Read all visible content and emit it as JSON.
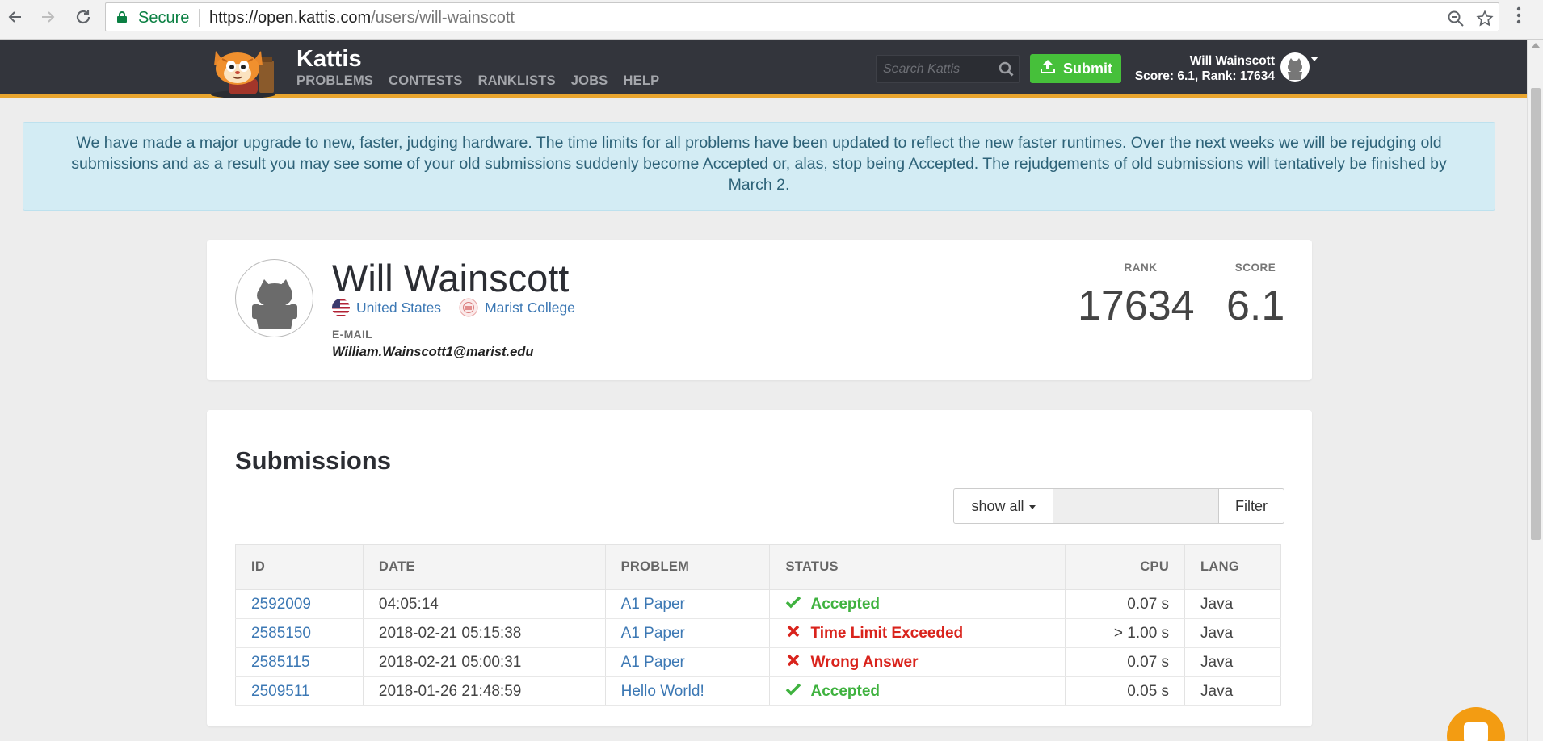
{
  "browser": {
    "secure_label": "Secure",
    "url_host": "https://open.kattis.com",
    "url_path": "/users/will-wainscott"
  },
  "header": {
    "brand": "Kattis",
    "nav": [
      "PROBLEMS",
      "CONTESTS",
      "RANKLISTS",
      "JOBS",
      "HELP"
    ],
    "search_placeholder": "Search Kattis",
    "submit_label": "Submit",
    "user_name": "Will Wainscott",
    "user_stats": "Score: 6.1, Rank: 17634"
  },
  "alert": {
    "text": "We have made a major upgrade to new, faster, judging hardware. The time limits for all problems have been updated to reflect the new faster runtimes. Over the next weeks we will be rejudging old submissions and as a result you may see some of your old submissions suddenly become Accepted or, alas, stop being Accepted. The rejudgements of old submissions will tentatively be finished by March 2."
  },
  "profile": {
    "name": "Will Wainscott",
    "country": "United States",
    "school": "Marist College",
    "email_label": "E-MAIL",
    "email": "William.Wainscott1@marist.edu",
    "rank_label": "RANK",
    "rank": "17634",
    "score_label": "SCORE",
    "score": "6.1"
  },
  "submissions": {
    "title": "Submissions",
    "filter_dropdown": "show all",
    "filter_input_value": "",
    "filter_button": "Filter",
    "columns": [
      "ID",
      "DATE",
      "PROBLEM",
      "STATUS",
      "CPU",
      "LANG"
    ],
    "rows": [
      {
        "id": "2592009",
        "date": "04:05:14",
        "problem": "A1 Paper",
        "status": "Accepted",
        "cpu": "0.07 s",
        "lang": "Java"
      },
      {
        "id": "2585150",
        "date": "2018-02-21 05:15:38",
        "problem": "A1 Paper",
        "status": "Time Limit Exceeded",
        "cpu": "> 1.00 s",
        "lang": "Java"
      },
      {
        "id": "2585115",
        "date": "2018-02-21 05:00:31",
        "problem": "A1 Paper",
        "status": "Wrong Answer",
        "cpu": "0.07 s",
        "lang": "Java"
      },
      {
        "id": "2509511",
        "date": "2018-01-26 21:48:59",
        "problem": "Hello World!",
        "status": "Accepted",
        "cpu": "0.05 s",
        "lang": "Java"
      }
    ]
  },
  "colors": {
    "header_bg": "#33353c",
    "header_accent": "#e9a52e",
    "submit_green": "#46c03a",
    "accepted": "#3fb23f",
    "rejected": "#d9231c",
    "link": "#3c78b4"
  },
  "icons": {
    "back": "back-arrow-icon",
    "forward": "forward-arrow-icon",
    "reload": "reload-icon",
    "secure": "lock-icon",
    "zoom": "zoom-icon",
    "bookmark": "star-icon",
    "menu": "kebab-menu-icon",
    "search": "search-icon",
    "submit": "upload-icon",
    "accepted": "check-icon",
    "rejected": "cross-icon",
    "chat": "chat-icon"
  }
}
